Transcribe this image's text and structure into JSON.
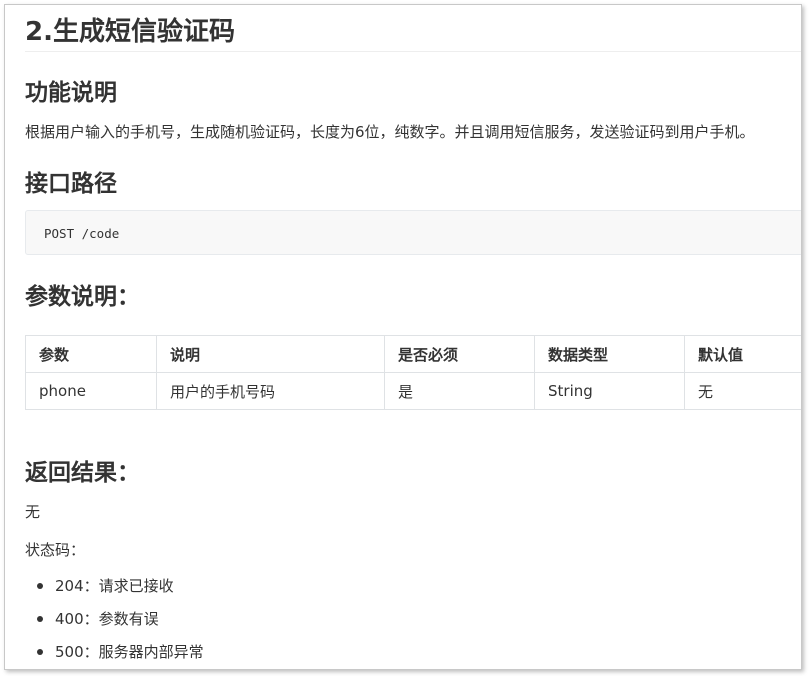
{
  "section_title": "2.生成短信验证码",
  "function_desc": {
    "heading": "功能说明",
    "text": "根据用户输入的手机号，生成随机验证码，长度为6位，纯数字。并且调用短信服务，发送验证码到用户手机。"
  },
  "api_path": {
    "heading": "接口路径",
    "code": "POST /code"
  },
  "params": {
    "heading": "参数说明：",
    "headers": [
      "参数",
      "说明",
      "是否必须",
      "数据类型",
      "默认值"
    ],
    "rows": [
      [
        "phone",
        "用户的手机号码",
        "是",
        "String",
        "无"
      ]
    ]
  },
  "result": {
    "heading": "返回结果：",
    "value": "无",
    "status_label": "状态码：",
    "status_codes": [
      "204：请求已接收",
      "400：参数有误",
      "500：服务器内部异常"
    ]
  }
}
